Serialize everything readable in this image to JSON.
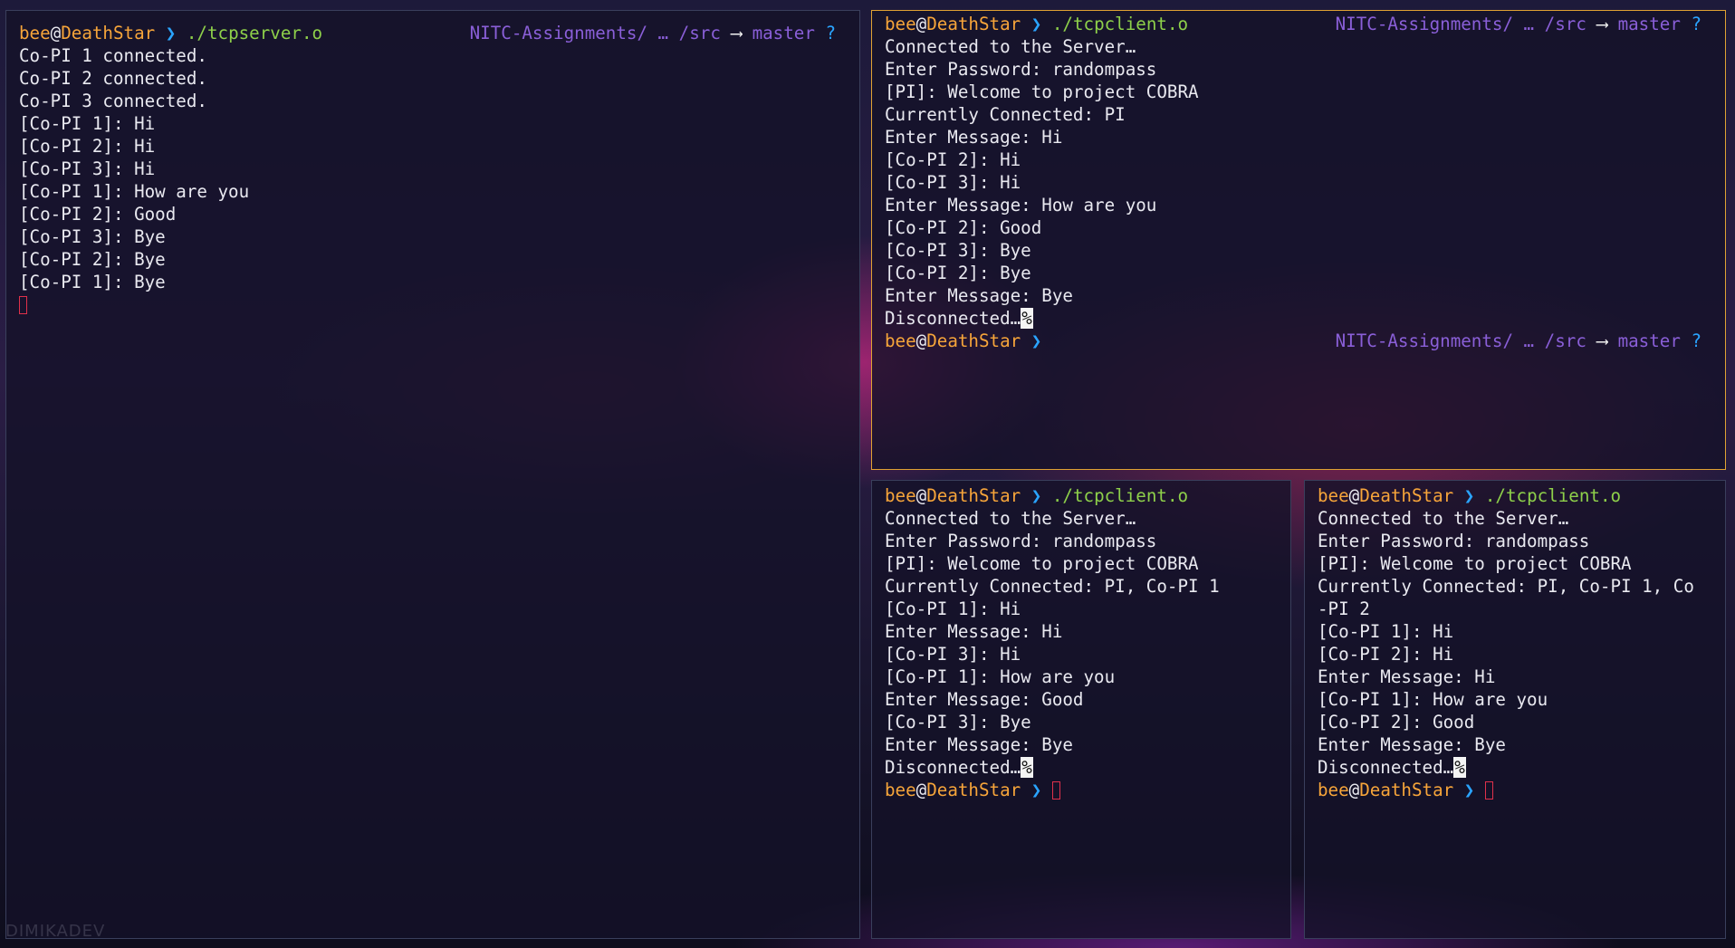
{
  "prompt": {
    "user": "bee",
    "at": "@",
    "host": "DeathStar",
    "chevron": "❯",
    "rprompt_path": "NITC-Assignments/ … /src",
    "rprompt_arrow": "⟶",
    "rprompt_branch": "master",
    "rprompt_status": "?"
  },
  "server_pane": {
    "command": "./tcpserver.o",
    "output": [
      "Co-PI 1 connected.",
      "Co-PI 2 connected.",
      "Co-PI 3 connected.",
      "[Co-PI 1]: Hi",
      "[Co-PI 2]: Hi",
      "[Co-PI 3]: Hi",
      "[Co-PI 1]: How are you",
      "[Co-PI 2]: Good",
      "[Co-PI 3]: Bye",
      "[Co-PI 2]: Bye",
      "[Co-PI 1]: Bye"
    ]
  },
  "client_pi_pane": {
    "command": "./tcpclient.o",
    "output": [
      "Connected to the Server…",
      "Enter Password: randompass",
      "[PI]: Welcome to project COBRA",
      "Currently Connected: PI",
      "Enter Message: Hi",
      "[Co-PI 2]: Hi",
      "[Co-PI 3]: Hi",
      "Enter Message: How are you",
      "[Co-PI 2]: Good",
      "[Co-PI 3]: Bye",
      "[Co-PI 2]: Bye",
      "Enter Message: Bye"
    ],
    "disconnect_text": "Disconnected…",
    "end_marker": "%"
  },
  "client_copi2_pane": {
    "command": "./tcpclient.o",
    "output": [
      "Connected to the Server…",
      "Enter Password: randompass",
      "[PI]: Welcome to project COBRA",
      "Currently Connected: PI, Co-PI 1",
      "[Co-PI 1]: Hi",
      "Enter Message: Hi",
      "[Co-PI 3]: Hi",
      "[Co-PI 1]: How are you",
      "Enter Message: Good",
      "[Co-PI 3]: Bye",
      "Enter Message: Bye"
    ],
    "disconnect_text": "Disconnected…",
    "end_marker": "%"
  },
  "client_copi3_pane": {
    "command": "./tcpclient.o",
    "output": [
      "Connected to the Server…",
      "Enter Password: randompass",
      "[PI]: Welcome to project COBRA",
      "Currently Connected: PI, Co-PI 1, Co",
      "-PI 2",
      "[Co-PI 1]: Hi",
      "[Co-PI 2]: Hi",
      "Enter Message: Hi",
      "[Co-PI 1]: How are you",
      "[Co-PI 2]: Good",
      "Enter Message: Bye"
    ],
    "disconnect_text": "Disconnected…",
    "end_marker": "%"
  },
  "watermark": "DIMIKADEV",
  "colors": {
    "user": "#f7a53a",
    "chevron": "#2aa4ff",
    "command": "#8ed04a",
    "path": "#8a5fd8",
    "active_border": "#e0a233",
    "cursor": "#e0314b"
  }
}
